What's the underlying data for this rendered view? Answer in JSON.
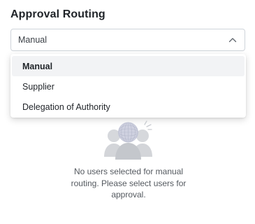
{
  "section": {
    "title": "Approval Routing"
  },
  "select": {
    "value": "Manual",
    "chevron_icon": "chevron-up-icon"
  },
  "menu": {
    "items": [
      {
        "label": "Manual",
        "selected": true
      },
      {
        "label": "Supplier",
        "selected": false
      },
      {
        "label": "Delegation of Authority",
        "selected": false
      }
    ]
  },
  "empty_state": {
    "illustration_icon": "users-group-icon",
    "message": "No users selected for manual routing. Please select users for approval."
  },
  "colors": {
    "border": "#cfd4da",
    "selected_bg": "#f2f3f5",
    "muted_text": "#54595f",
    "illustration": "#d6d8dc"
  }
}
